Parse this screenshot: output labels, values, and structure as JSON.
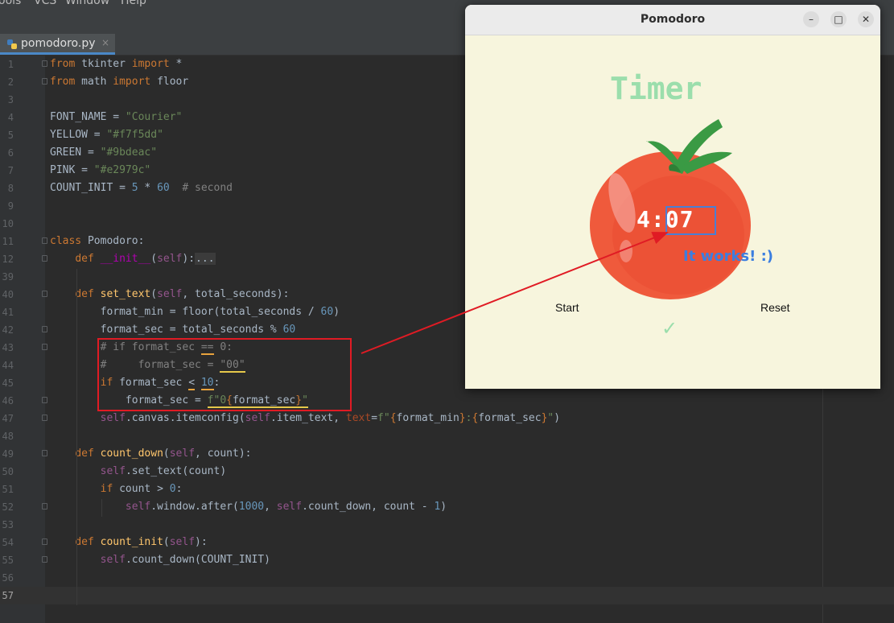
{
  "menubar": {
    "items": [
      "ools",
      "VCS",
      "Window",
      "Help"
    ]
  },
  "editor": {
    "tab": {
      "label": "pomodoro.py",
      "close": "×"
    },
    "lines": [
      {
        "num": "1",
        "html": "<span class='kw'>from</span> tkinter <span class='kw'>import</span> *"
      },
      {
        "num": "2",
        "html": "<span class='kw'>from</span> math <span class='kw'>import</span> floor"
      },
      {
        "num": "3",
        "html": ""
      },
      {
        "num": "4",
        "html": "FONT_NAME = <span class='str'>\"Courier\"</span>"
      },
      {
        "num": "5",
        "html": "YELLOW = <span class='str'>\"#f7f5dd\"</span>"
      },
      {
        "num": "6",
        "html": "GREEN = <span class='str'>\"#9bdeac\"</span>"
      },
      {
        "num": "7",
        "html": "PINK = <span class='str'>\"#e2979c\"</span>"
      },
      {
        "num": "8",
        "html": "COUNT_INIT = <span class='num'>5</span> * <span class='num'>60</span>  <span class='cmt'># second</span>"
      },
      {
        "num": "9",
        "html": ""
      },
      {
        "num": "10",
        "html": ""
      },
      {
        "num": "11",
        "html": "<span class='kw'>class</span> Pomodoro:"
      },
      {
        "num": "12",
        "html": "    <span class='kw'>def</span> <span class='magic'>__init__</span>(<span class='selfkw'>self</span>):<span class='folded'>...</span>"
      },
      {
        "num": "39",
        "html": ""
      },
      {
        "num": "40",
        "html": "    <span class='kw'>def</span> <span class='fn'>set_text</span>(<span class='selfkw'>self</span>, total_seconds):"
      },
      {
        "num": "41",
        "html": "        format_min = floor(total_seconds / <span class='num'>60</span>)"
      },
      {
        "num": "42",
        "html": "        format_sec = total_seconds % <span class='num'>60</span>"
      },
      {
        "num": "43",
        "html": "        <span class='cmt'># if format_sec <span class='u-orange'>==</span> 0:</span>"
      },
      {
        "num": "44",
        "html": "        <span class='cmt'>#     format_sec = <span class='u-yellow'>\"00\"</span></span>"
      },
      {
        "num": "45",
        "html": "        <span class='kw'>if</span> format_sec <span class='u-orange'>&lt;</span> <span class='num u-orange'>10</span>:"
      },
      {
        "num": "46",
        "html": "            format_sec = <span class='u-yellow'><span class='str'>f\"0</span><span class='kw'>{</span>format_sec<span class='kw'>}</span><span class='str'>\"</span></span>"
      },
      {
        "num": "47",
        "html": "        <span class='selfkw'>self</span>.canvas.itemconfig(<span class='selfkw'>self</span>.item_text, <span class='param'>text</span>=<span class='str'>f\"</span><span class='kw'>{</span>format_min<span class='kw'>}</span><span class='str'>:</span><span class='kw'>{</span>format_sec<span class='kw'>}</span><span class='str'>\"</span>)"
      },
      {
        "num": "48",
        "html": ""
      },
      {
        "num": "49",
        "html": "    <span class='kw'>def</span> <span class='fn'>count_down</span>(<span class='selfkw'>self</span>, count):"
      },
      {
        "num": "50",
        "html": "        <span class='selfkw'>self</span>.set_text(count)"
      },
      {
        "num": "51",
        "html": "        <span class='kw'>if</span> count &gt; <span class='num'>0</span>:"
      },
      {
        "num": "52",
        "html": "            <span class='selfkw'>self</span>.window.after(<span class='num'>1000</span>, <span class='selfkw'>self</span>.count_down, count - <span class='num'>1</span>)"
      },
      {
        "num": "53",
        "html": ""
      },
      {
        "num": "54",
        "html": "    <span class='kw'>def</span> <span class='fn'>count_init</span>(<span class='selfkw'>self</span>):"
      },
      {
        "num": "55",
        "html": "        <span class='selfkw'>self</span>.count_down(COUNT_INIT)"
      },
      {
        "num": "56",
        "html": ""
      },
      {
        "num": "57",
        "html": ""
      }
    ]
  },
  "pomodoro_window": {
    "title": "Pomodoro",
    "controls": {
      "minimize": "–",
      "maximize": "□",
      "close": "✕"
    },
    "timer_label": "Timer",
    "time_minutes": "4",
    "time_separator": ":",
    "time_seconds": "07",
    "note": "It works! :)",
    "start_button": "Start",
    "reset_button": "Reset",
    "checkmark": "✓"
  },
  "colors": {
    "yellow": "#f7f5dd",
    "green": "#9bdeac",
    "tomato": "#ef5a3c",
    "annotation_red": "#e01b24",
    "annotation_blue": "#4a7fd4"
  }
}
